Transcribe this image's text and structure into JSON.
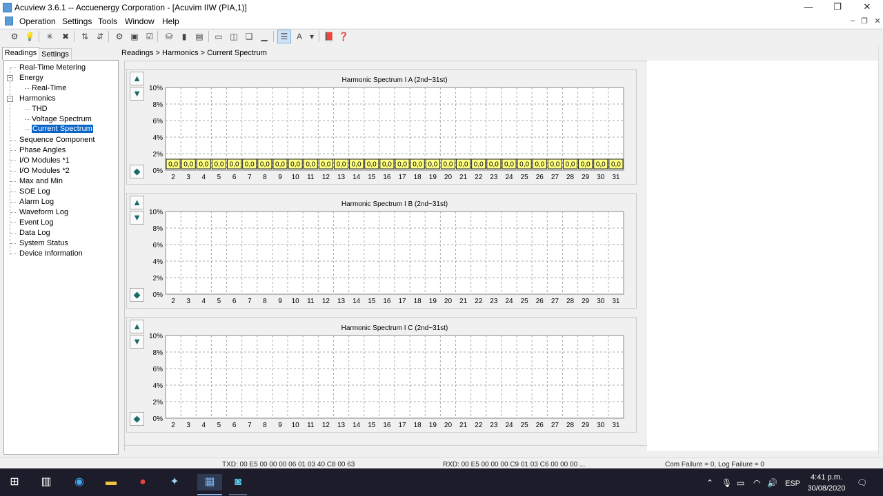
{
  "window": {
    "title": "Acuview 3.6.1 -- Accuenergy Corporation - [Acuvim IIW (PIA,1)]",
    "minimize_glyph": "—",
    "restore_glyph": "❐",
    "close_glyph": "✕"
  },
  "menu": [
    "Operation",
    "Settings",
    "Tools",
    "Window",
    "Help"
  ],
  "mdi_controls": [
    "–",
    "❐",
    "✕"
  ],
  "left_tabs": {
    "readings": "Readings",
    "settings": "Settings"
  },
  "tree": {
    "items": [
      {
        "label": "Real-Time Metering"
      },
      {
        "label": "Energy"
      },
      {
        "label": "Real-Time"
      },
      {
        "label": "Harmonics"
      },
      {
        "label": "THD"
      },
      {
        "label": "Voltage Spectrum"
      },
      {
        "label": "Current Spectrum"
      },
      {
        "label": "Sequence Component"
      },
      {
        "label": "Phase Angles"
      },
      {
        "label": "I/O Modules *1"
      },
      {
        "label": "I/O Modules *2"
      },
      {
        "label": "Max and Min"
      },
      {
        "label": "SOE Log"
      },
      {
        "label": "Alarm Log"
      },
      {
        "label": "Waveform Log"
      },
      {
        "label": "Event Log"
      },
      {
        "label": "Data Log"
      },
      {
        "label": "System Status"
      },
      {
        "label": "Device Information"
      }
    ],
    "selected": "Current Spectrum"
  },
  "breadcrumb": "Readings > Harmonics > Current Spectrum",
  "chart_data": [
    {
      "type": "bar",
      "title": "Harmonic Spectrum I A (2nd~31st)",
      "categories": [
        "2",
        "3",
        "4",
        "5",
        "6",
        "7",
        "8",
        "9",
        "10",
        "11",
        "12",
        "13",
        "14",
        "15",
        "16",
        "17",
        "18",
        "19",
        "20",
        "21",
        "22",
        "23",
        "24",
        "25",
        "26",
        "27",
        "28",
        "29",
        "30",
        "31"
      ],
      "values": [
        0,
        0,
        0,
        0,
        0,
        0,
        0,
        0,
        0,
        0,
        0,
        0,
        0,
        0,
        0,
        0,
        0,
        0,
        0,
        0,
        0,
        0,
        0,
        0,
        0,
        0,
        0,
        0,
        0,
        0
      ],
      "data_labels": [
        "0,0",
        "0,0",
        "0,0",
        "0,0",
        "0,0",
        "0,0",
        "0,0",
        "0,0",
        "0,0",
        "0,0",
        "0,0",
        "0,0",
        "0,0",
        "0,0",
        "0,0",
        "0,0",
        "0,0",
        "0,0",
        "0,0",
        "0,0",
        "0,0",
        "0,0",
        "0,0",
        "0,0",
        "0,0",
        "0,0",
        "0,0",
        "0,0",
        "0,0",
        "0,0"
      ],
      "show_data_labels": true,
      "yticks": [
        "0%",
        "2%",
        "4%",
        "6%",
        "8%",
        "10%"
      ],
      "ylim": [
        0,
        10
      ],
      "grid": true
    },
    {
      "type": "bar",
      "title": "Harmonic Spectrum I B (2nd~31st)",
      "categories": [
        "2",
        "3",
        "4",
        "5",
        "6",
        "7",
        "8",
        "9",
        "10",
        "11",
        "12",
        "13",
        "14",
        "15",
        "16",
        "17",
        "18",
        "19",
        "20",
        "21",
        "22",
        "23",
        "24",
        "25",
        "26",
        "27",
        "28",
        "29",
        "30",
        "31"
      ],
      "values": [],
      "show_data_labels": false,
      "yticks": [
        "0%",
        "2%",
        "4%",
        "6%",
        "8%",
        "10%"
      ],
      "ylim": [
        0,
        10
      ],
      "grid": true
    },
    {
      "type": "bar",
      "title": "Harmonic Spectrum I C (2nd~31st)",
      "categories": [
        "2",
        "3",
        "4",
        "5",
        "6",
        "7",
        "8",
        "9",
        "10",
        "11",
        "12",
        "13",
        "14",
        "15",
        "16",
        "17",
        "18",
        "19",
        "20",
        "21",
        "22",
        "23",
        "24",
        "25",
        "26",
        "27",
        "28",
        "29",
        "30",
        "31"
      ],
      "values": [],
      "show_data_labels": false,
      "yticks": [
        "0%",
        "2%",
        "4%",
        "6%",
        "8%",
        "10%"
      ],
      "ylim": [
        0,
        10
      ],
      "grid": true
    }
  ],
  "chart_nav": {
    "up": "▲",
    "down": "▼",
    "left_right": "◆"
  },
  "status": {
    "txd": "TXD:  00 E5 00 00 00 06 01 03 40 C8 00 63",
    "rxd": "RXD:  00 E5 00 00 00 C9 01 03 C6 00 00 00 ...",
    "failures": "Com Failure = 0, Log Failure = 0"
  },
  "taskbar": {
    "language": "ESP",
    "time": "4:41 p.m.",
    "date": "30/08/2020"
  },
  "colors": {
    "selection": "#0a64c8",
    "data_label_bg": "#ffff80",
    "taskbar": "#1c1c2a",
    "nav_arrow": "#196b6b"
  }
}
